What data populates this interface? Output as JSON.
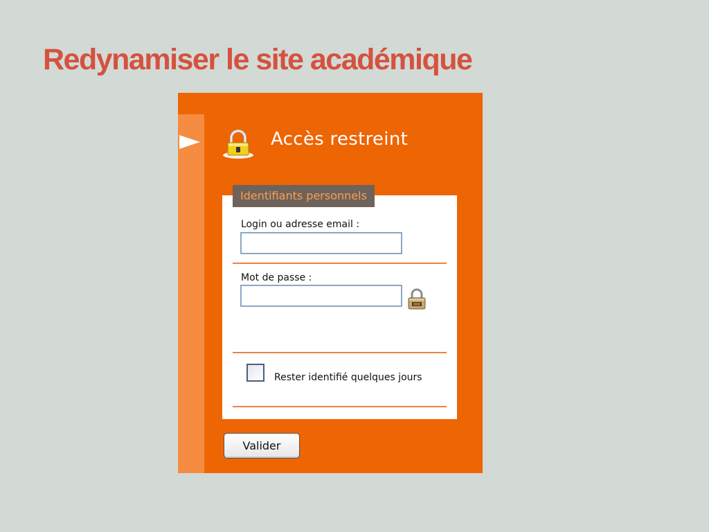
{
  "slide": {
    "title": "Redynamiser le site académique"
  },
  "panel": {
    "heading": "Accès restreint",
    "icons": {
      "collapse": "triangle-arrow-right-icon",
      "header_lock": "padlock-icon",
      "password_lock": "padlock-icon"
    }
  },
  "form": {
    "legend": "Identifiants personnels",
    "login": {
      "label": "Login ou adresse email :",
      "value": "",
      "placeholder": ""
    },
    "password": {
      "label": "Mot de passe :",
      "value": "",
      "placeholder": ""
    },
    "remember": {
      "label": "Rester identifié quelques jours",
      "checked": false
    },
    "submit_label": "Valider"
  },
  "colors": {
    "background": "#d3d9d5",
    "title": "#d4523f",
    "panel_orange": "#ee6504",
    "side_strip": "#f58c41",
    "legend_bg": "#6f625a",
    "legend_text": "#f7a04f"
  }
}
